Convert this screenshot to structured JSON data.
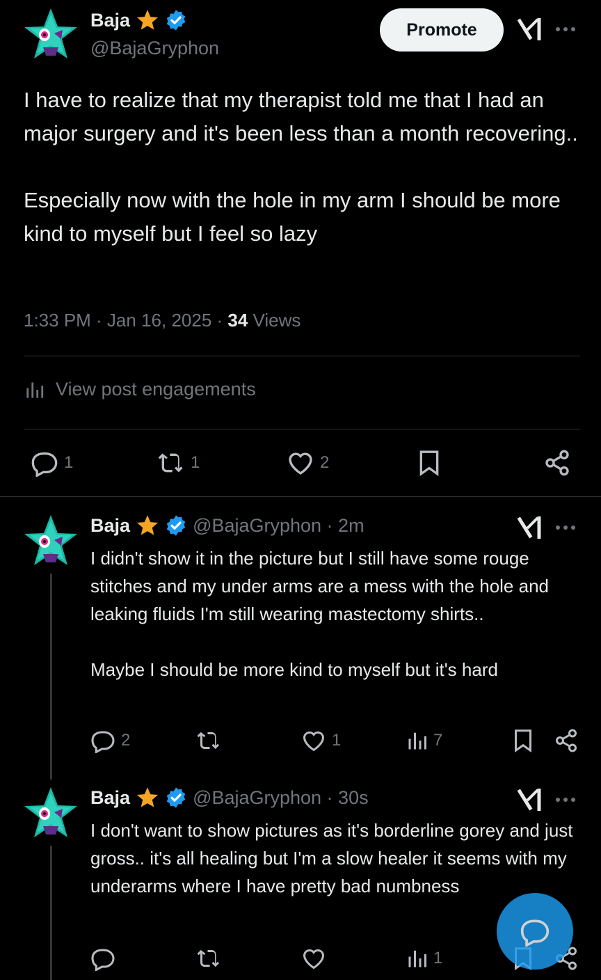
{
  "main_post": {
    "author_name": "Baja",
    "handle": "@BajaGryphon",
    "promote_label": "Promote",
    "text": "I have to realize that my therapist told me that I had an major surgery and it's been less than a month recovering..\n\nEspecially now with the hole in my arm I should be more kind to myself but I feel so lazy",
    "timestamp": "1:33 PM · Jan 16, 2025 · ",
    "views_count": "34",
    "views_label": " Views",
    "engagements_label": "View post engagements",
    "actions": {
      "replies": "1",
      "reposts": "1",
      "likes": "2"
    }
  },
  "replies": [
    {
      "author_name": "Baja",
      "handle": "@BajaGryphon · 2m",
      "text": "I didn't show it in the picture but I still have some rouge stitches and my under arms are a mess with the hole and leaking fluids I'm still wearing mastectomy shirts..\n\nMaybe I should be more kind to myself but it's hard",
      "replies": "2",
      "reposts": "",
      "likes": "1",
      "views": "7"
    },
    {
      "author_name": "Baja",
      "handle": "@BajaGryphon · 30s",
      "text": "I don't want to show pictures as it's borderline gorey and just gross.. it's all healing but I'm a slow healer it seems with my underarms where I have pretty bad numbness",
      "replies": "",
      "reposts": "",
      "likes": "",
      "views": "1"
    }
  ],
  "icons": {
    "star_badge": "star-icon",
    "verified": "verified-icon",
    "grok": "grok-icon",
    "more": "more-icon",
    "reply": "reply-icon",
    "repost": "repost-icon",
    "like": "like-icon",
    "bookmark": "bookmark-icon",
    "share": "share-icon",
    "views": "views-icon",
    "compose": "compose-icon"
  },
  "colors": {
    "accent": "#1d9bf0",
    "star": "#f4a623",
    "background": "#000000",
    "text": "#e7e9ea",
    "muted": "#71767b"
  }
}
